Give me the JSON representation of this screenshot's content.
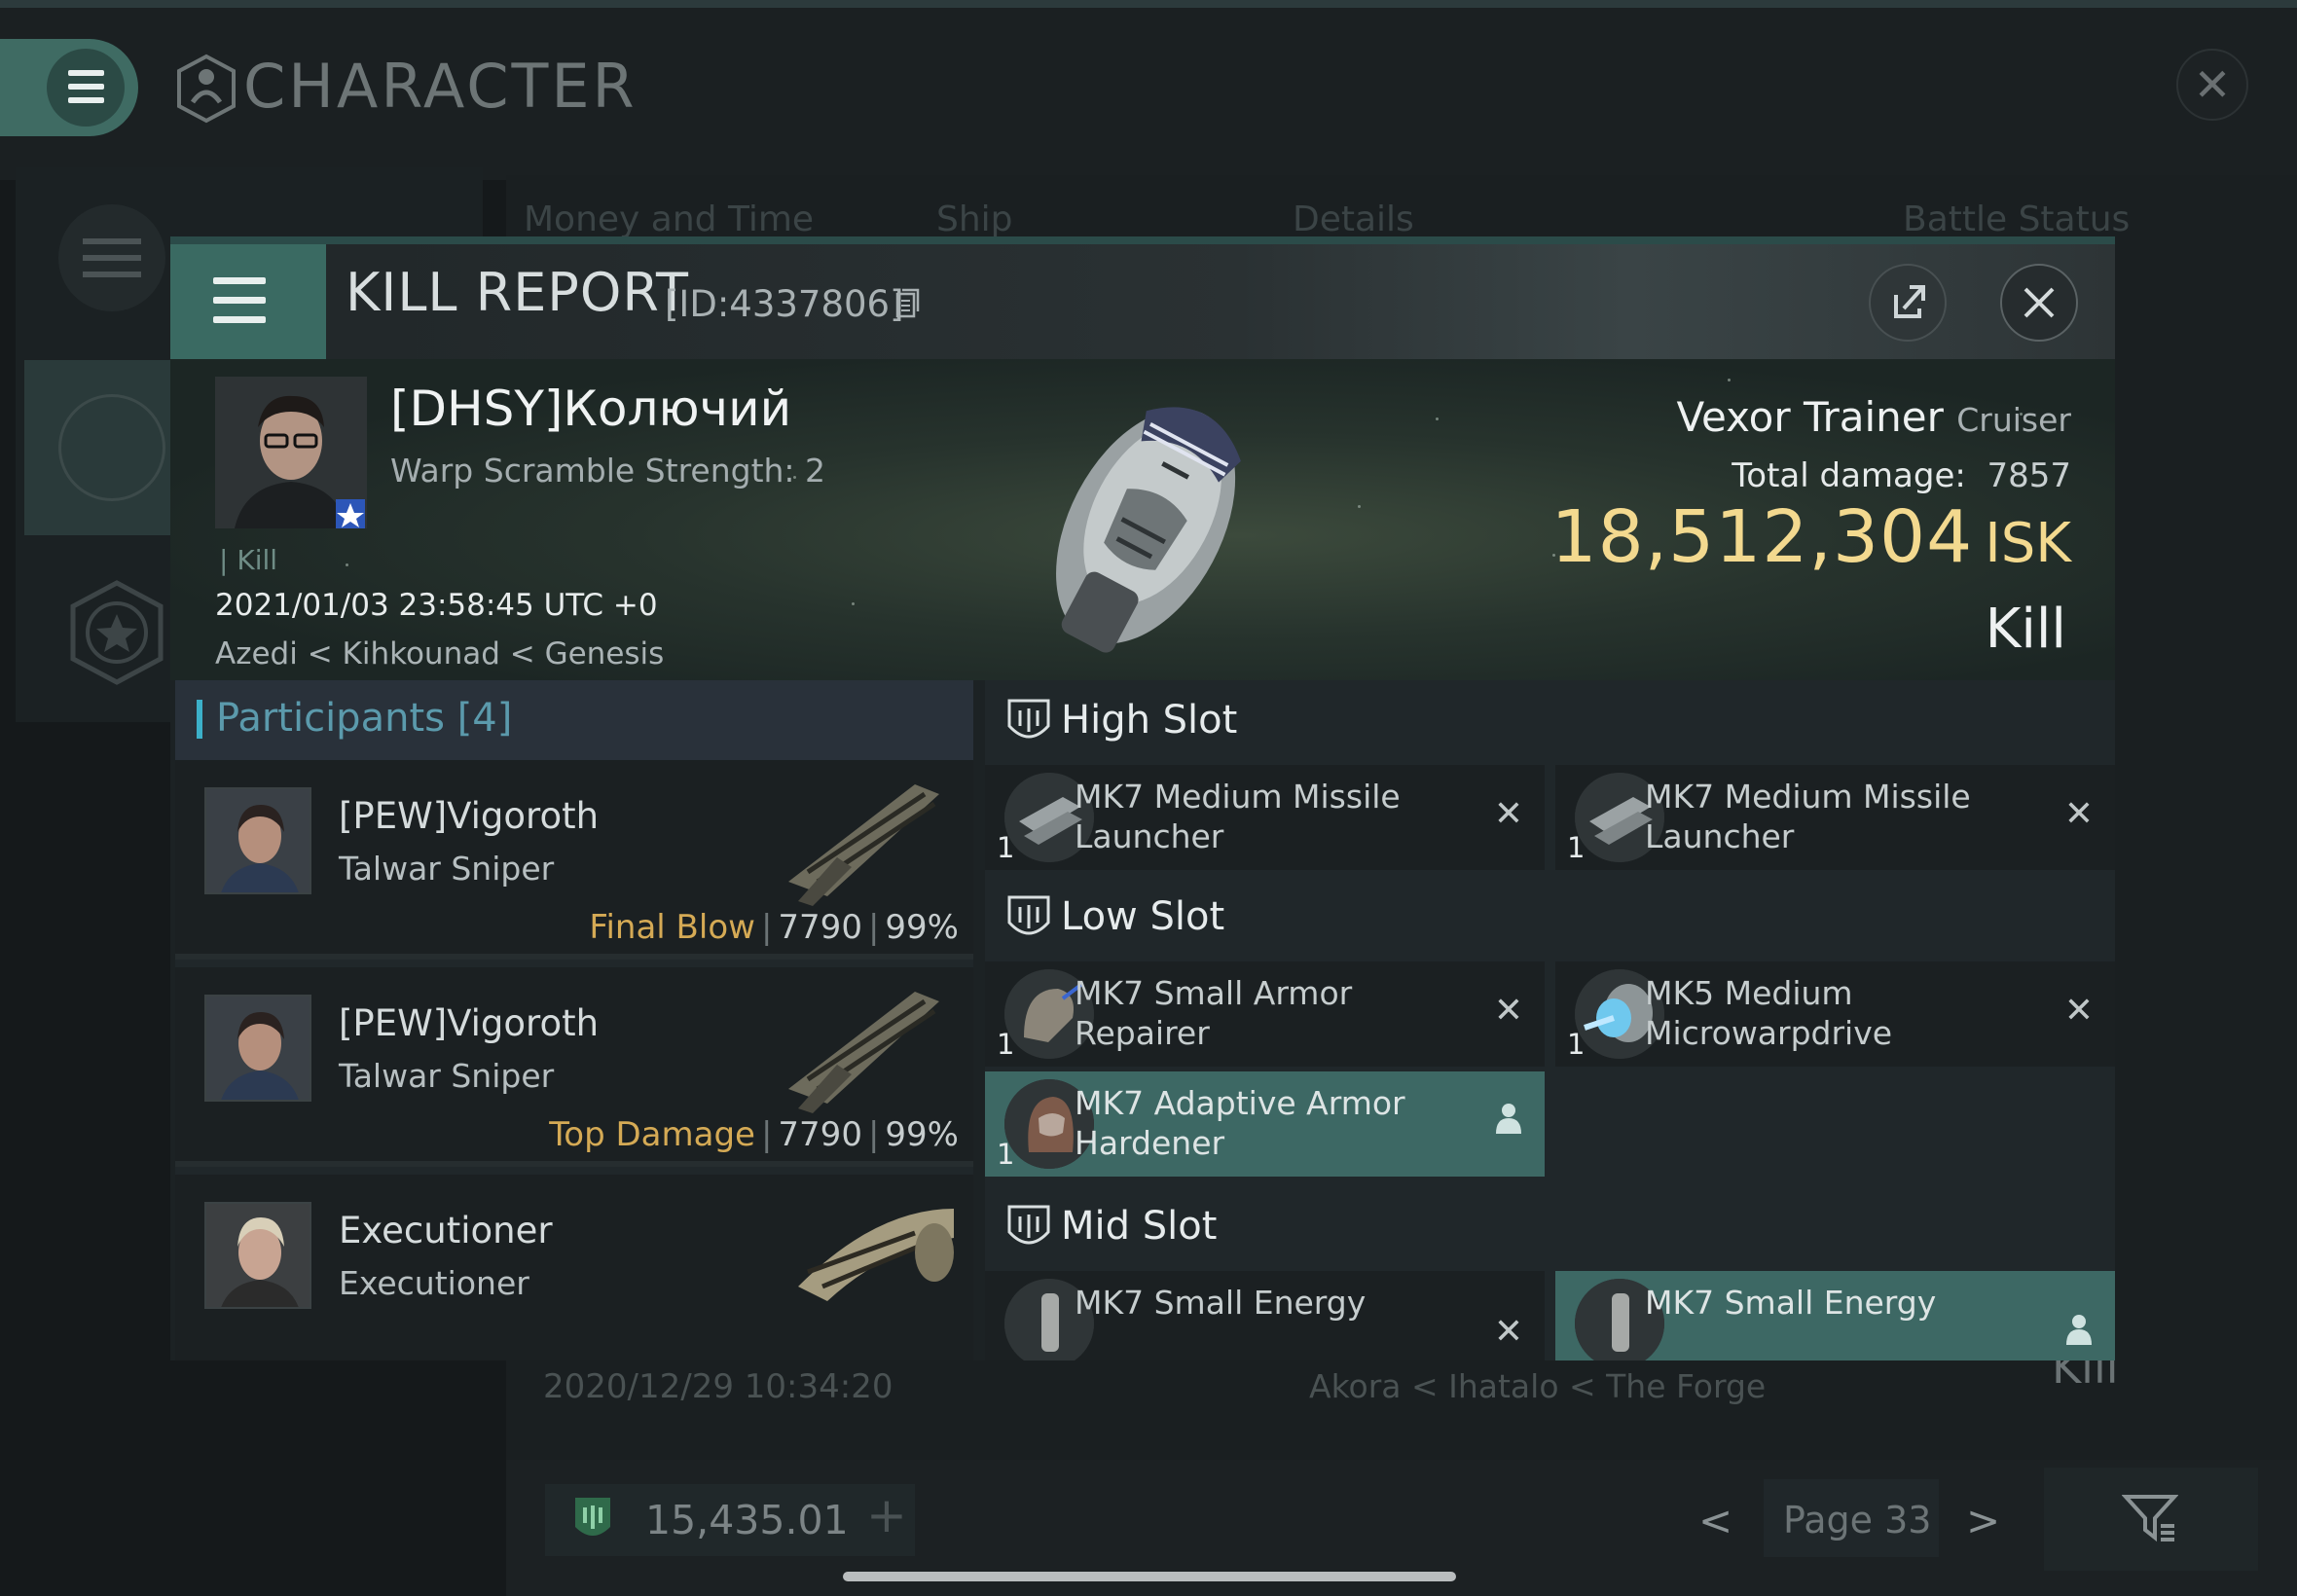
{
  "app": {
    "title": "CHARACTER",
    "background_tabs": [
      "Money and Time",
      "Ship",
      "Details",
      "Battle Status"
    ],
    "background_row": {
      "date": "2020/12/29  10:34:20",
      "location": "Akora < Ihatalo < The Forge",
      "result": "Kill"
    },
    "isk_balance": "15,435.01",
    "page_label": "Page 33"
  },
  "report": {
    "title": "KILL REPORT",
    "id_label": "[ID:4337806]",
    "victim": {
      "name": "[DHSY]Колючий",
      "warp_scramble": "Warp Scramble Strength: 2",
      "tag": "Kill",
      "time": "2021/01/03 23:58:45 UTC +0",
      "location": "Azedi < Kihkounad < Genesis"
    },
    "ship": {
      "name": "Vexor Trainer",
      "class": "Cruiser",
      "damage_label": "Total damage:",
      "damage_value": "7857",
      "isk_value": "18,512,304",
      "isk_unit": "ISK",
      "result": "Kill"
    }
  },
  "participants": {
    "title": "Participants",
    "count": "[4]",
    "items": [
      {
        "name": "[PEW]Vigoroth",
        "ship": "Talwar Sniper",
        "tag": "Final Blow",
        "damage": "7790",
        "percent": "99%"
      },
      {
        "name": "[PEW]Vigoroth",
        "ship": "Talwar Sniper",
        "tag": "Top Damage",
        "damage": "7790",
        "percent": "99%"
      },
      {
        "name": "Executioner",
        "ship": "Executioner"
      }
    ]
  },
  "slots": {
    "high": {
      "label": "High Slot",
      "modules": [
        {
          "qty": "1",
          "name": "MK7 Medium Missile Launcher"
        },
        {
          "qty": "1",
          "name": "MK7 Medium Missile Launcher"
        }
      ]
    },
    "low": {
      "label": "Low Slot",
      "modules": [
        {
          "qty": "1",
          "name": "MK7 Small Armor Repairer"
        },
        {
          "qty": "1",
          "name": "MK5 Medium Microwarpdrive"
        },
        {
          "qty": "1",
          "name": "MK7 Adaptive Armor Hardener"
        }
      ]
    },
    "mid": {
      "label": "Mid Slot",
      "modules": [
        {
          "name": "MK7 Small Energy"
        },
        {
          "name": "MK7 Small Energy"
        }
      ]
    }
  },
  "colors": {
    "accent": "#3a6a62",
    "isk": "#f3d98f",
    "tag": "#d5aa55",
    "participants": "#5b9aac"
  }
}
